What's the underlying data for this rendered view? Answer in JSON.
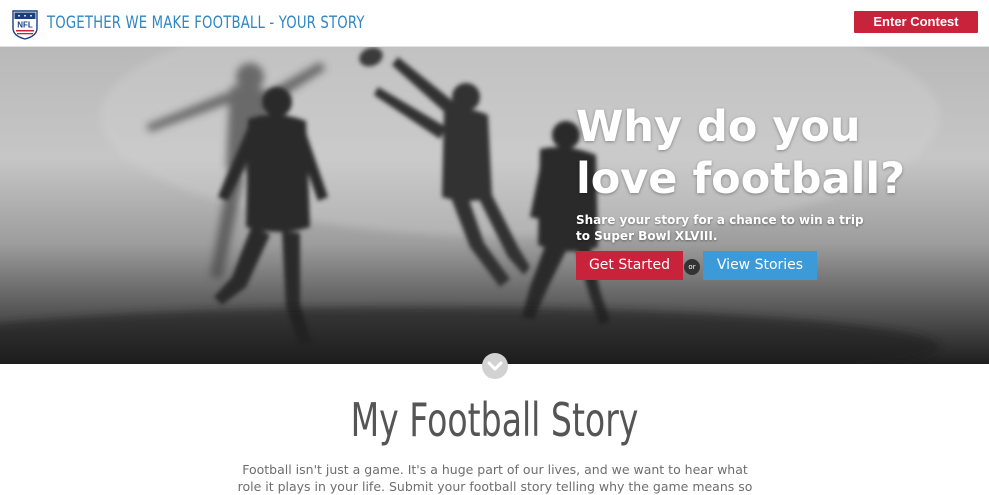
{
  "header": {
    "logo_text": "NFL",
    "title": "TOGETHER WE MAKE FOOTBALL - YOUR STORY",
    "enter_contest_label": "Enter Contest"
  },
  "hero": {
    "headline": "Why do you love football?",
    "subheadline": "Share your story for a chance to win a trip to Super Bowl XLVIII.",
    "get_started_label": "Get Started",
    "or_label": "or",
    "view_stories_label": "View Stories",
    "scroll_icon": "chevron-down-icon"
  },
  "main": {
    "section_title": "My Football Story",
    "section_body": "Football isn't just a game. It's a huge part of our lives, and we want to hear what role it plays in your life. Submit your football story telling why the game means so"
  },
  "colors": {
    "accent_red": "#c8233b",
    "accent_blue": "#3c9ad8",
    "title_blue": "#2f86c3"
  }
}
